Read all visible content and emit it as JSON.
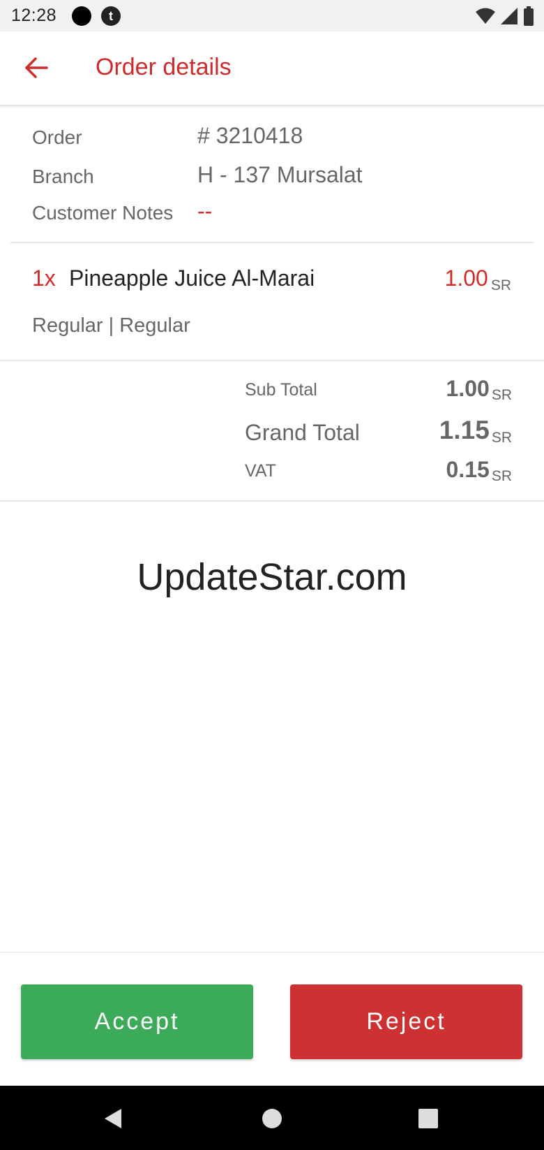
{
  "status_bar": {
    "time": "12:28",
    "app_icon_letter": "t"
  },
  "app_bar": {
    "title": "Order details"
  },
  "order": {
    "order_label": "Order",
    "order_value": "# 3210418",
    "branch_label": "Branch",
    "branch_value": "H - 137 Mursalat",
    "notes_label": "Customer Notes",
    "notes_value": "--"
  },
  "item": {
    "qty": "1x",
    "name": "Pineapple Juice Al-Marai",
    "price": "1.00",
    "currency": "SR",
    "options": "Regular | Regular"
  },
  "totals": {
    "subtotal_label": "Sub Total",
    "subtotal_value": "1.00",
    "grand_label": "Grand Total",
    "grand_value": "1.15",
    "vat_label": "VAT",
    "vat_value": "0.15",
    "currency": "SR"
  },
  "watermark": "UpdateStar.com",
  "actions": {
    "accept_label": "Accept",
    "reject_label": "Reject"
  },
  "colors": {
    "accent": "#d12a2a",
    "accept": "#3bab59",
    "reject": "#cd3132"
  },
  "icons": {
    "back": "arrow-left-icon",
    "wifi": "wifi-icon",
    "signal": "signal-icon",
    "battery": "battery-icon",
    "nav_back": "nav-back-icon",
    "nav_home": "nav-home-icon",
    "nav_recents": "nav-recents-icon"
  }
}
